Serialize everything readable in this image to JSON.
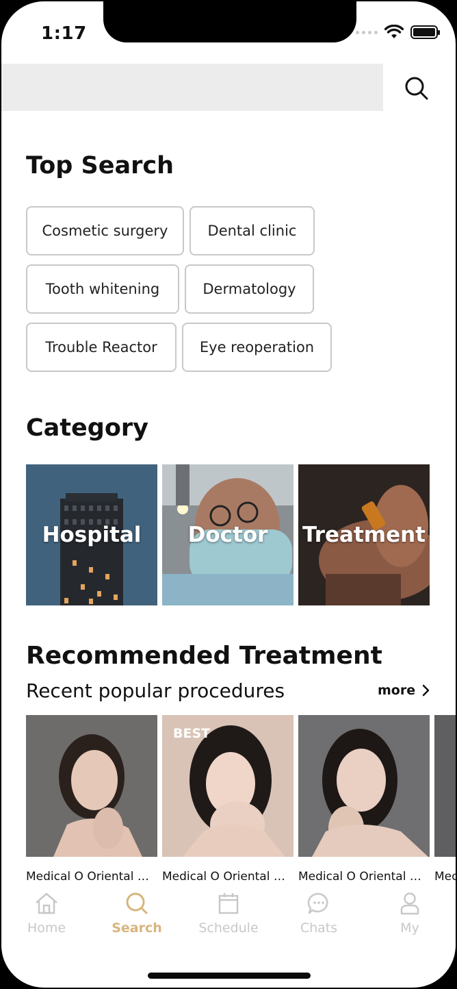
{
  "status": {
    "time": "1:17"
  },
  "search": {
    "placeholder": ""
  },
  "top_search": {
    "title": "Top Search",
    "chips": [
      "Cosmetic surgery",
      "Dental clinic",
      "Tooth whitening",
      "Dermatology",
      "Trouble Reactor",
      "Eye reoperation"
    ]
  },
  "category": {
    "title": "Category",
    "items": [
      "Hospital",
      "Doctor",
      "Treatment"
    ]
  },
  "recommended": {
    "title": "Recommended Treatment",
    "subtitle": "Recent popular procedures",
    "more_label": "more",
    "badge": "BEST",
    "cards": [
      "Medical O Oriental …",
      "Medical O Oriental …",
      "Medical O Oriental …",
      "Mec"
    ]
  },
  "tabbar": {
    "items": [
      "Home",
      "Search",
      "Schedule",
      "Chats",
      "My"
    ],
    "active": "Search"
  },
  "colors": {
    "accent": "#d8b57e",
    "inactive_tab": "#c8c8c8",
    "search_bar_bg": "#ececec",
    "chip_border": "#c8c8c8"
  },
  "icons": [
    "search-icon",
    "home-icon",
    "schedule-icon",
    "chat-icon",
    "user-icon",
    "chevron-right-icon",
    "wifi-icon",
    "battery-icon",
    "signal-icon"
  ]
}
